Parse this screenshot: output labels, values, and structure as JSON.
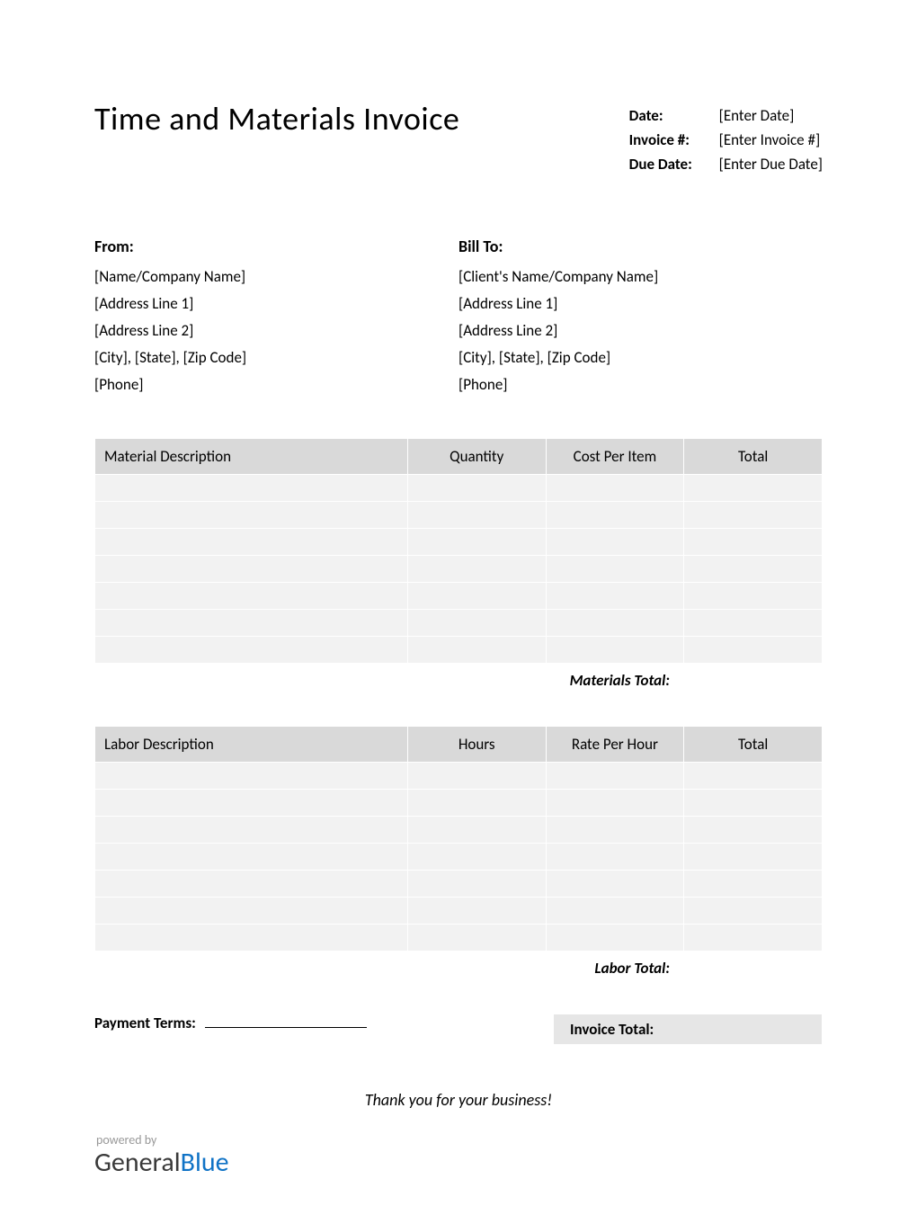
{
  "title": "Time and Materials Invoice",
  "meta": {
    "date_label": "Date:",
    "date_value": "[Enter Date]",
    "invoice_label": "Invoice #:",
    "invoice_value": "[Enter Invoice #]",
    "due_label": "Due Date:",
    "due_value": "[Enter Due Date]"
  },
  "from": {
    "heading": "From:",
    "lines": [
      "[Name/Company Name]",
      "[Address Line 1]",
      "[Address Line 2]",
      "[City], [State], [Zip Code]",
      "[Phone]"
    ]
  },
  "billto": {
    "heading": "Bill To:",
    "lines": [
      "[Client's Name/Company Name]",
      "[Address Line 1]",
      "[Address Line 2]",
      "[City], [State], [Zip Code]",
      "[Phone]"
    ]
  },
  "materials": {
    "headers": [
      "Material Description",
      "Quantity",
      "Cost Per Item",
      "Total"
    ],
    "subtotal_label": "Materials Total:"
  },
  "labor": {
    "headers": [
      "Labor Description",
      "Hours",
      "Rate Per Hour",
      "Total"
    ],
    "subtotal_label": "Labor Total:"
  },
  "payment_terms_label": "Payment Terms:",
  "invoice_total_label": "Invoice Total:",
  "thanks": "Thank you for your business!",
  "logo": {
    "powered": "powered by",
    "general": "General",
    "blue": "Blue"
  }
}
